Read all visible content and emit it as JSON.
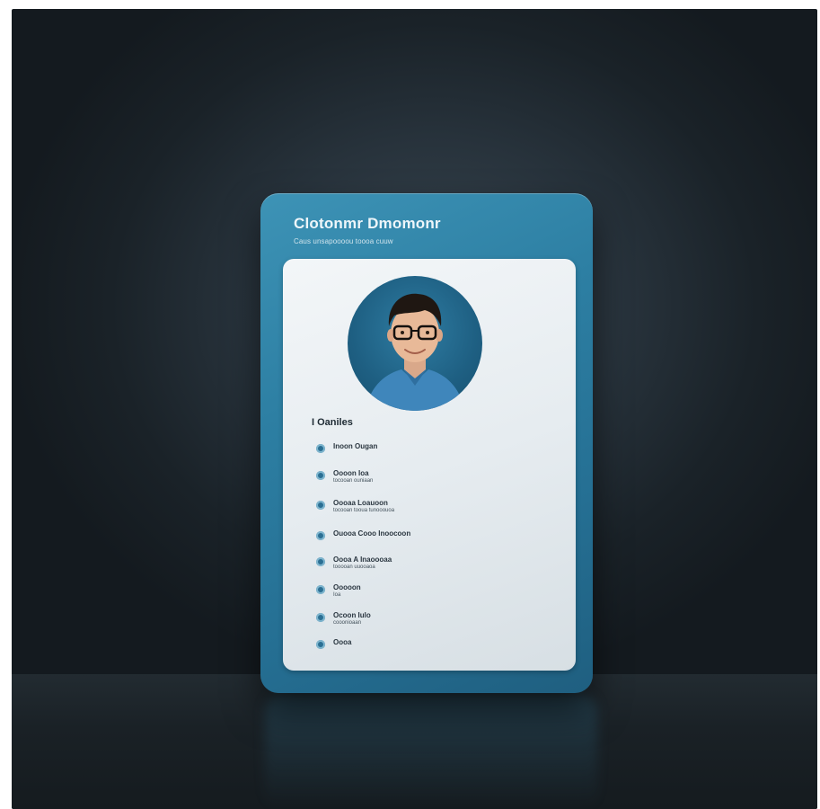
{
  "card": {
    "title": "Clotonmr Dmomonr",
    "subtitle": "Caus unsapoooou toooa cuuw"
  },
  "profile": {
    "photo_icon": "person-portrait-icon"
  },
  "section": {
    "heading": "I Oaniles"
  },
  "items": [
    {
      "line1": "Inoon Ougan",
      "line2": ""
    },
    {
      "line1": "Oooon Ioa",
      "line2": "tocooan ouniaan"
    },
    {
      "line1": "Oooaa Loauoon",
      "line2": "tocooan tooua tunooouoa"
    },
    {
      "line1": "Ouooa Cooo Inoocoon",
      "line2": ""
    },
    {
      "line1": "Oooa A Inaoooaa",
      "line2": "tooooan uuooaoa"
    },
    {
      "line1": "Ooooon",
      "line2": "Ioa"
    },
    {
      "line1": "Ocoon Iulo",
      "line2": "cooonioaan"
    },
    {
      "line1": "Oooa",
      "line2": ""
    }
  ],
  "colors": {
    "card_blue": "#2d7fa3",
    "panel": "#eef2f5",
    "bullet": "#2b6f93",
    "background": "#1f2930"
  }
}
